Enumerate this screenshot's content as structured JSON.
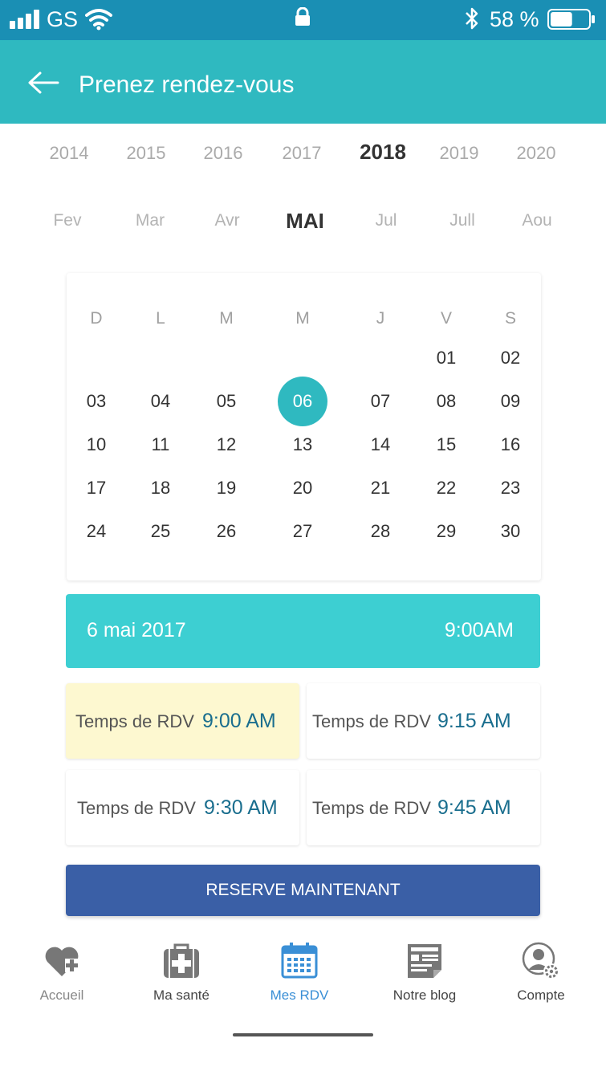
{
  "status_bar": {
    "carrier": "GS",
    "battery_text": "58 %",
    "battery_level": 0.58
  },
  "header": {
    "title": "Prenez rendez-vous"
  },
  "years": [
    "2014",
    "2015",
    "2016",
    "2017",
    "2018",
    "2019",
    "2020"
  ],
  "selected_year": "2018",
  "months": [
    "Fev",
    "Mar",
    "Avr",
    "MAI",
    "Jul",
    "Jull",
    "Aou"
  ],
  "selected_month": "MAI",
  "calendar": {
    "weekdays": [
      "D",
      "L",
      "M",
      "M",
      "J",
      "V",
      "S"
    ],
    "weeks": [
      [
        "",
        "",
        "",
        "",
        "",
        "01",
        "02"
      ],
      [
        "03",
        "04",
        "05",
        "06",
        "07",
        "08",
        "09"
      ],
      [
        "10",
        "11",
        "12",
        "13",
        "14",
        "15",
        "16"
      ],
      [
        "17",
        "18",
        "19",
        "20",
        "21",
        "22",
        "23"
      ],
      [
        "24",
        "25",
        "26",
        "27",
        "28",
        "29",
        "30"
      ]
    ],
    "selected_day": "06"
  },
  "summary": {
    "date": "6 mai 2017",
    "time": "9:00AM"
  },
  "slots": [
    {
      "label": "Temps de RDV",
      "time": "9:00 AM",
      "selected": true
    },
    {
      "label": "Temps de RDV",
      "time": "9:15 AM",
      "selected": false
    },
    {
      "label": "Temps de RDV",
      "time": "9:30 AM",
      "selected": false
    },
    {
      "label": "Temps de RDV",
      "time": "9:45 AM",
      "selected": false
    }
  ],
  "reserve_button": "RESERVE MAINTENANT",
  "nav": [
    {
      "label": "Accueil",
      "icon": "heart-plus-icon",
      "state": "dim"
    },
    {
      "label": "Ma santé",
      "icon": "medical-kit-icon",
      "state": "normal"
    },
    {
      "label": "Mes RDV",
      "icon": "calendar-icon",
      "state": "active"
    },
    {
      "label": "Notre blog",
      "icon": "blog-icon",
      "state": "normal"
    },
    {
      "label": "Compte",
      "icon": "account-settings-icon",
      "state": "normal"
    }
  ],
  "colors": {
    "status_bar": "#1a8fb4",
    "header": "#2fb9c0",
    "accent": "#2fb9c0",
    "summary": "#3dcfd2",
    "selected_slot": "#fdf8d0",
    "button": "#3a5fa6",
    "nav_active": "#3a8fd6"
  }
}
